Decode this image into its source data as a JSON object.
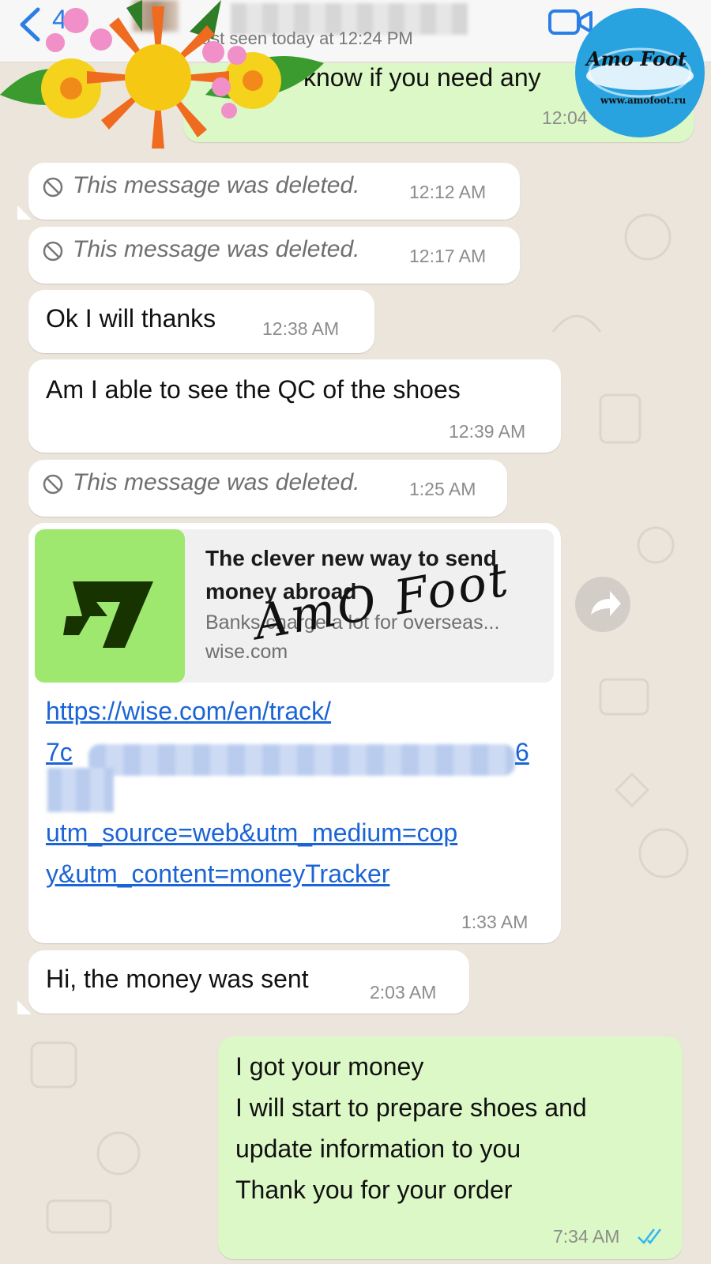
{
  "header": {
    "back_count": "48",
    "last_seen": "last seen today at 12:24 PM"
  },
  "messages": [
    {
      "id": "m0",
      "direction": "outgoing",
      "text": "know if you need any",
      "time": "12:04"
    },
    {
      "id": "m1",
      "direction": "incoming",
      "deleted": true,
      "text": "This message was deleted.",
      "time": "12:12 AM"
    },
    {
      "id": "m2",
      "direction": "incoming",
      "deleted": true,
      "text": "This message was deleted.",
      "time": "12:17 AM"
    },
    {
      "id": "m3",
      "direction": "incoming",
      "text": "Ok I will thanks",
      "time": "12:38 AM"
    },
    {
      "id": "m4",
      "direction": "incoming",
      "text": "Am I able to see the QC of the shoes",
      "time": "12:39 AM"
    },
    {
      "id": "m5",
      "direction": "incoming",
      "deleted": true,
      "text": "This message was deleted.",
      "time": "1:25 AM"
    },
    {
      "id": "m6",
      "direction": "incoming",
      "time": "1:33 AM",
      "preview": {
        "title": "The clever new way to send money abroad",
        "description": "Banks charge a lot for overseas...",
        "domain": "wise.com"
      },
      "link_lines": [
        "https://wise.com/en/track/",
        "7c",
        "6",
        "utm_source=web&utm_medium=cop",
        "y&utm_content=moneyTracker"
      ]
    },
    {
      "id": "m7",
      "direction": "incoming",
      "text": "Hi, the money was sent",
      "time": "2:03 AM"
    },
    {
      "id": "m8",
      "direction": "outgoing",
      "lines": [
        "I got your money",
        "I will start to prepare shoes and",
        "update information to you",
        "Thank you for your order"
      ],
      "time": "7:34 AM",
      "status": "read"
    }
  ],
  "overlay": {
    "logo_text": "Amo Foot",
    "logo_url": "www.amofoot.ru",
    "signature": "AmO Foot"
  },
  "colors": {
    "incoming": "#ffffff",
    "outgoing": "#dcf8c6",
    "link": "#1b64d6",
    "read_ticks": "#34b7f1",
    "wise_green": "#9fe870"
  }
}
